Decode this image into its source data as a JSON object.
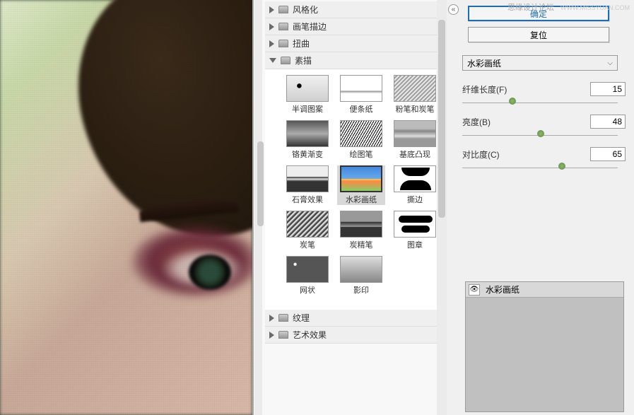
{
  "watermark": {
    "text": "思缘设计论坛",
    "url": "WWW.MISSYUAN.COM"
  },
  "buttons": {
    "ok": "确定",
    "reset": "复位"
  },
  "categories": [
    {
      "label": "风格化",
      "open": false
    },
    {
      "label": "画笔描边",
      "open": false
    },
    {
      "label": "扭曲",
      "open": false
    },
    {
      "label": "素描",
      "open": true
    },
    {
      "label": "纹理",
      "open": false
    },
    {
      "label": "艺术效果",
      "open": false
    }
  ],
  "filters": [
    {
      "label": "半调图案"
    },
    {
      "label": "便条纸"
    },
    {
      "label": "粉笔和炭笔"
    },
    {
      "label": "铬黄渐变"
    },
    {
      "label": "绘图笔"
    },
    {
      "label": "基底凸现"
    },
    {
      "label": "石膏效果"
    },
    {
      "label": "水彩画纸",
      "selected": true
    },
    {
      "label": "撕边"
    },
    {
      "label": "炭笔"
    },
    {
      "label": "炭精笔"
    },
    {
      "label": "图章"
    },
    {
      "label": "网状"
    },
    {
      "label": "影印"
    }
  ],
  "dropdown": {
    "value": "水彩画纸"
  },
  "params": [
    {
      "label": "纤维长度(F)",
      "value": "15",
      "pos": 30
    },
    {
      "label": "亮度(B)",
      "value": "48",
      "pos": 48
    },
    {
      "label": "对比度(C)",
      "value": "65",
      "pos": 62
    }
  ],
  "effect_preview": {
    "title": "水彩画纸"
  }
}
